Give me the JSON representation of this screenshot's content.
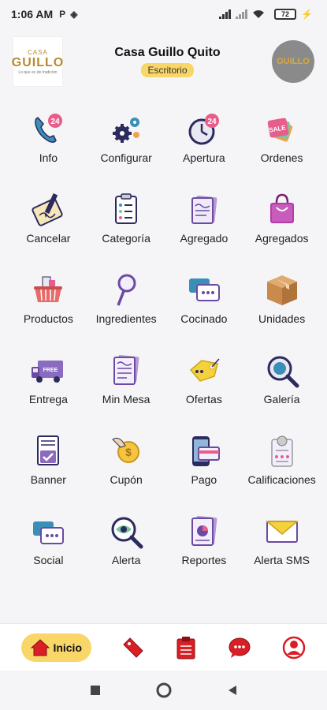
{
  "status_bar": {
    "time": "1:06 AM",
    "battery": "72"
  },
  "header": {
    "logo_left": {
      "casa": "CASA",
      "guillo": "GUILLO",
      "tagline": "Lo que es de tradición"
    },
    "title": "Casa Guillo Quito",
    "badge": "Escritorio",
    "logo_right": "GUILLO"
  },
  "grid": {
    "info": "Info",
    "configurar": "Configurar",
    "apertura": "Apertura",
    "ordenes": "Ordenes",
    "cancelar": "Cancelar",
    "categoria": "Categoría",
    "agregado": "Agregado",
    "agregados": "Agregados",
    "productos": "Productos",
    "ingredientes": "Ingredientes",
    "cocinado": "Cocinado",
    "unidades": "Unidades",
    "entrega": "Entrega",
    "min_mesa": "Min Mesa",
    "ofertas": "Ofertas",
    "galeria": "Galería",
    "banner": "Banner",
    "cupon": "Cupón",
    "pago": "Pago",
    "calificaciones": "Calificaciones",
    "social": "Social",
    "alerta": "Alerta",
    "reportes": "Reportes",
    "alerta_sms": "Alerta SMS"
  },
  "icon_text": {
    "badge_24": "24",
    "sale": "SALE",
    "free": "FREE"
  },
  "bottom_nav": {
    "home_label": "Inicio"
  },
  "colors": {
    "accent": "#f8d667",
    "nav_red": "#d81f26"
  }
}
